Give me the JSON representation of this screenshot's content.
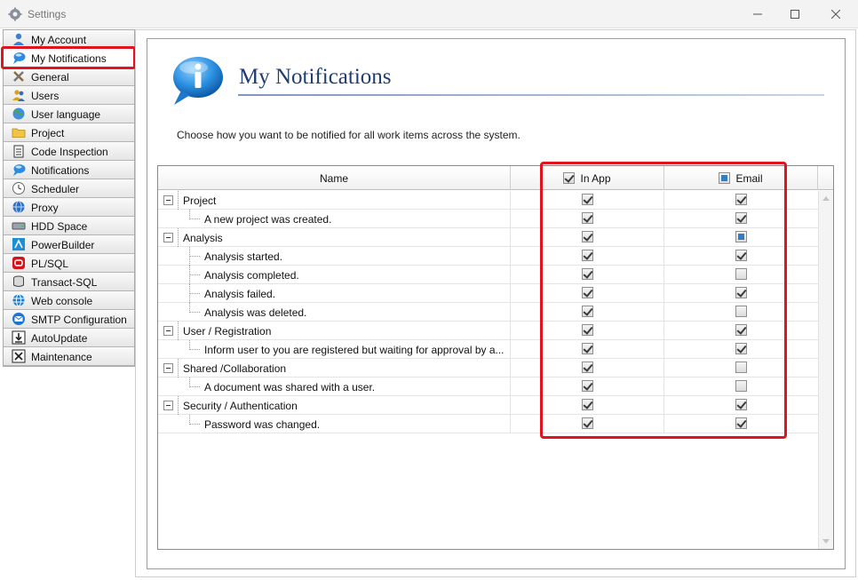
{
  "window": {
    "title": "Settings",
    "minimize_glyph": "—",
    "maximize_glyph": "☐",
    "close_glyph": "✕"
  },
  "sidebar": {
    "items": [
      {
        "label": "My Account",
        "icon": "user-icon"
      },
      {
        "label": "My Notifications",
        "icon": "speech-bubble-icon",
        "selected": true
      },
      {
        "label": "General",
        "icon": "tools-icon"
      },
      {
        "label": "Users",
        "icon": "users-icon"
      },
      {
        "label": "User language",
        "icon": "globe-icon"
      },
      {
        "label": "Project",
        "icon": "folder-icon"
      },
      {
        "label": "Code Inspection",
        "icon": "clipboard-icon"
      },
      {
        "label": "Notifications",
        "icon": "speech-bubble-icon"
      },
      {
        "label": "Scheduler",
        "icon": "clock-icon"
      },
      {
        "label": "Proxy",
        "icon": "network-globe-icon"
      },
      {
        "label": "HDD Space",
        "icon": "hard-drive-icon"
      },
      {
        "label": "PowerBuilder",
        "icon": "powerbuilder-icon"
      },
      {
        "label": "PL/SQL",
        "icon": "plsql-icon"
      },
      {
        "label": "Transact-SQL",
        "icon": "database-icon"
      },
      {
        "label": "Web console",
        "icon": "web-icon"
      },
      {
        "label": "SMTP Configuration",
        "icon": "mail-icon"
      },
      {
        "label": "AutoUpdate",
        "icon": "download-icon"
      },
      {
        "label": "Maintenance",
        "icon": "wrench-icon"
      }
    ]
  },
  "page": {
    "title": "My Notifications",
    "description": "Choose how you want to be notified for all work items across the system."
  },
  "grid": {
    "columns": {
      "name": "Name",
      "in_app": "In App",
      "email": "Email"
    },
    "header_checkbox_states": {
      "in_app": "checked",
      "email": "indeterminate"
    },
    "rows": [
      {
        "type": "group",
        "label": "Project",
        "in_app": "checked",
        "email": "checked"
      },
      {
        "type": "item",
        "label": "A new project was created.",
        "in_app": "checked",
        "email": "checked"
      },
      {
        "type": "group",
        "label": "Analysis",
        "in_app": "checked",
        "email": "indeterminate"
      },
      {
        "type": "item",
        "label": "Analysis started.",
        "in_app": "checked",
        "email": "checked"
      },
      {
        "type": "item",
        "label": "Analysis completed.",
        "in_app": "checked",
        "email": "unchecked"
      },
      {
        "type": "item",
        "label": "Analysis failed.",
        "in_app": "checked",
        "email": "checked"
      },
      {
        "type": "item",
        "label": "Analysis was deleted.",
        "in_app": "checked",
        "email": "unchecked"
      },
      {
        "type": "group",
        "label": "User / Registration",
        "in_app": "checked",
        "email": "checked"
      },
      {
        "type": "item",
        "label": "Inform user to you are registered but waiting for approval by a...",
        "in_app": "checked",
        "email": "checked"
      },
      {
        "type": "group",
        "label": "Shared /Collaboration",
        "in_app": "checked",
        "email": "unchecked"
      },
      {
        "type": "item",
        "label": "A document was shared with a user.",
        "in_app": "checked",
        "email": "unchecked"
      },
      {
        "type": "group",
        "label": "Security / Authentication",
        "in_app": "checked",
        "email": "checked"
      },
      {
        "type": "item",
        "label": "Password was changed.",
        "in_app": "checked",
        "email": "checked"
      }
    ]
  },
  "colors": {
    "highlight": "#e0141e",
    "title": "#1f3d6e",
    "indeterminate": "#2f7fc6"
  }
}
